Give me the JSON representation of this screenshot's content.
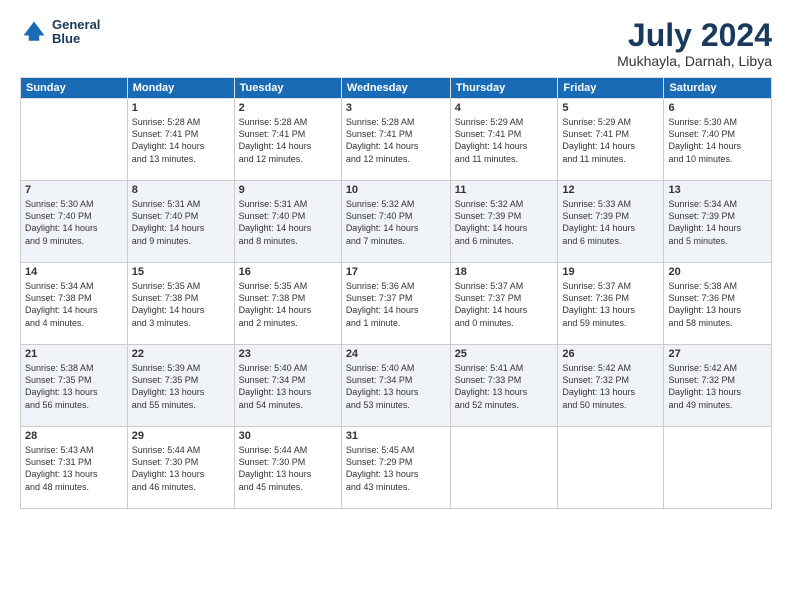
{
  "header": {
    "logo": {
      "line1": "General",
      "line2": "Blue"
    },
    "title": "July 2024",
    "location": "Mukhayla, Darnah, Libya"
  },
  "days_of_week": [
    "Sunday",
    "Monday",
    "Tuesday",
    "Wednesday",
    "Thursday",
    "Friday",
    "Saturday"
  ],
  "weeks": [
    [
      {
        "day": "",
        "info": ""
      },
      {
        "day": "1",
        "info": "Sunrise: 5:28 AM\nSunset: 7:41 PM\nDaylight: 14 hours\nand 13 minutes."
      },
      {
        "day": "2",
        "info": "Sunrise: 5:28 AM\nSunset: 7:41 PM\nDaylight: 14 hours\nand 12 minutes."
      },
      {
        "day": "3",
        "info": "Sunrise: 5:28 AM\nSunset: 7:41 PM\nDaylight: 14 hours\nand 12 minutes."
      },
      {
        "day": "4",
        "info": "Sunrise: 5:29 AM\nSunset: 7:41 PM\nDaylight: 14 hours\nand 11 minutes."
      },
      {
        "day": "5",
        "info": "Sunrise: 5:29 AM\nSunset: 7:41 PM\nDaylight: 14 hours\nand 11 minutes."
      },
      {
        "day": "6",
        "info": "Sunrise: 5:30 AM\nSunset: 7:40 PM\nDaylight: 14 hours\nand 10 minutes."
      }
    ],
    [
      {
        "day": "7",
        "info": "Sunrise: 5:30 AM\nSunset: 7:40 PM\nDaylight: 14 hours\nand 9 minutes."
      },
      {
        "day": "8",
        "info": "Sunrise: 5:31 AM\nSunset: 7:40 PM\nDaylight: 14 hours\nand 9 minutes."
      },
      {
        "day": "9",
        "info": "Sunrise: 5:31 AM\nSunset: 7:40 PM\nDaylight: 14 hours\nand 8 minutes."
      },
      {
        "day": "10",
        "info": "Sunrise: 5:32 AM\nSunset: 7:40 PM\nDaylight: 14 hours\nand 7 minutes."
      },
      {
        "day": "11",
        "info": "Sunrise: 5:32 AM\nSunset: 7:39 PM\nDaylight: 14 hours\nand 6 minutes."
      },
      {
        "day": "12",
        "info": "Sunrise: 5:33 AM\nSunset: 7:39 PM\nDaylight: 14 hours\nand 6 minutes."
      },
      {
        "day": "13",
        "info": "Sunrise: 5:34 AM\nSunset: 7:39 PM\nDaylight: 14 hours\nand 5 minutes."
      }
    ],
    [
      {
        "day": "14",
        "info": "Sunrise: 5:34 AM\nSunset: 7:38 PM\nDaylight: 14 hours\nand 4 minutes."
      },
      {
        "day": "15",
        "info": "Sunrise: 5:35 AM\nSunset: 7:38 PM\nDaylight: 14 hours\nand 3 minutes."
      },
      {
        "day": "16",
        "info": "Sunrise: 5:35 AM\nSunset: 7:38 PM\nDaylight: 14 hours\nand 2 minutes."
      },
      {
        "day": "17",
        "info": "Sunrise: 5:36 AM\nSunset: 7:37 PM\nDaylight: 14 hours\nand 1 minute."
      },
      {
        "day": "18",
        "info": "Sunrise: 5:37 AM\nSunset: 7:37 PM\nDaylight: 14 hours\nand 0 minutes."
      },
      {
        "day": "19",
        "info": "Sunrise: 5:37 AM\nSunset: 7:36 PM\nDaylight: 13 hours\nand 59 minutes."
      },
      {
        "day": "20",
        "info": "Sunrise: 5:38 AM\nSunset: 7:36 PM\nDaylight: 13 hours\nand 58 minutes."
      }
    ],
    [
      {
        "day": "21",
        "info": "Sunrise: 5:38 AM\nSunset: 7:35 PM\nDaylight: 13 hours\nand 56 minutes."
      },
      {
        "day": "22",
        "info": "Sunrise: 5:39 AM\nSunset: 7:35 PM\nDaylight: 13 hours\nand 55 minutes."
      },
      {
        "day": "23",
        "info": "Sunrise: 5:40 AM\nSunset: 7:34 PM\nDaylight: 13 hours\nand 54 minutes."
      },
      {
        "day": "24",
        "info": "Sunrise: 5:40 AM\nSunset: 7:34 PM\nDaylight: 13 hours\nand 53 minutes."
      },
      {
        "day": "25",
        "info": "Sunrise: 5:41 AM\nSunset: 7:33 PM\nDaylight: 13 hours\nand 52 minutes."
      },
      {
        "day": "26",
        "info": "Sunrise: 5:42 AM\nSunset: 7:32 PM\nDaylight: 13 hours\nand 50 minutes."
      },
      {
        "day": "27",
        "info": "Sunrise: 5:42 AM\nSunset: 7:32 PM\nDaylight: 13 hours\nand 49 minutes."
      }
    ],
    [
      {
        "day": "28",
        "info": "Sunrise: 5:43 AM\nSunset: 7:31 PM\nDaylight: 13 hours\nand 48 minutes."
      },
      {
        "day": "29",
        "info": "Sunrise: 5:44 AM\nSunset: 7:30 PM\nDaylight: 13 hours\nand 46 minutes."
      },
      {
        "day": "30",
        "info": "Sunrise: 5:44 AM\nSunset: 7:30 PM\nDaylight: 13 hours\nand 45 minutes."
      },
      {
        "day": "31",
        "info": "Sunrise: 5:45 AM\nSunset: 7:29 PM\nDaylight: 13 hours\nand 43 minutes."
      },
      {
        "day": "",
        "info": ""
      },
      {
        "day": "",
        "info": ""
      },
      {
        "day": "",
        "info": ""
      }
    ]
  ]
}
